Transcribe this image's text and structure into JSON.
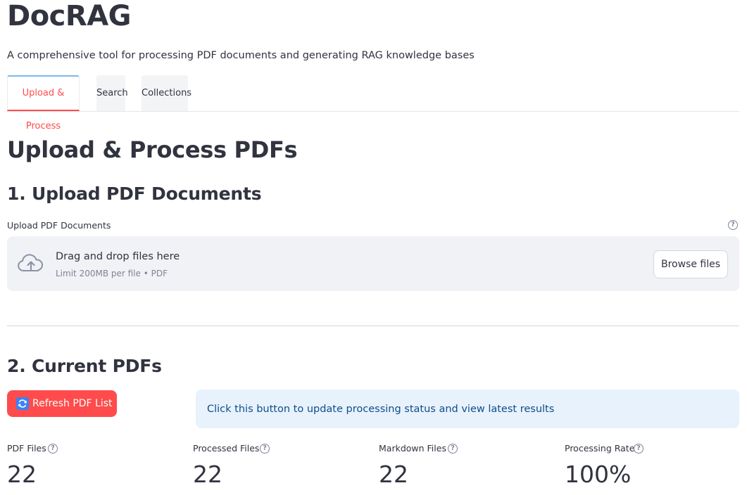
{
  "app": {
    "title": "DocRAG",
    "subtitle": "A comprehensive tool for processing PDF documents and generating RAG knowledge bases"
  },
  "tabs": [
    {
      "label": "Upload & Process",
      "active": true
    },
    {
      "label": "Search",
      "active": false
    },
    {
      "label": "Collections",
      "active": false
    }
  ],
  "main": {
    "page_title": "Upload & Process PDFs",
    "section1_title": "1. Upload PDF Documents",
    "upload": {
      "label": "Upload PDF Documents",
      "help_icon": "question-circle-icon",
      "drop_title": "Drag and drop files here",
      "drop_limit": "Limit 200MB per file • PDF",
      "browse_label": "Browse files",
      "upload_icon": "cloud-upload-icon"
    },
    "section2_title": "2. Current PDFs",
    "refresh_label": "Refresh PDF List",
    "refresh_icon": "refresh-icon",
    "info_text": "Click this button to update processing status and view latest results",
    "metrics": [
      {
        "label": "PDF Files",
        "value": "22"
      },
      {
        "label": "Processed Files",
        "value": "22"
      },
      {
        "label": "Markdown Files",
        "value": "22"
      },
      {
        "label": "Processing Rate",
        "value": "100%"
      }
    ]
  },
  "colors": {
    "accent": "#ff4b4b",
    "info_bg": "#e8f2fc",
    "info_text": "#0f4d8a",
    "dropzone_bg": "#f0f2f6"
  }
}
